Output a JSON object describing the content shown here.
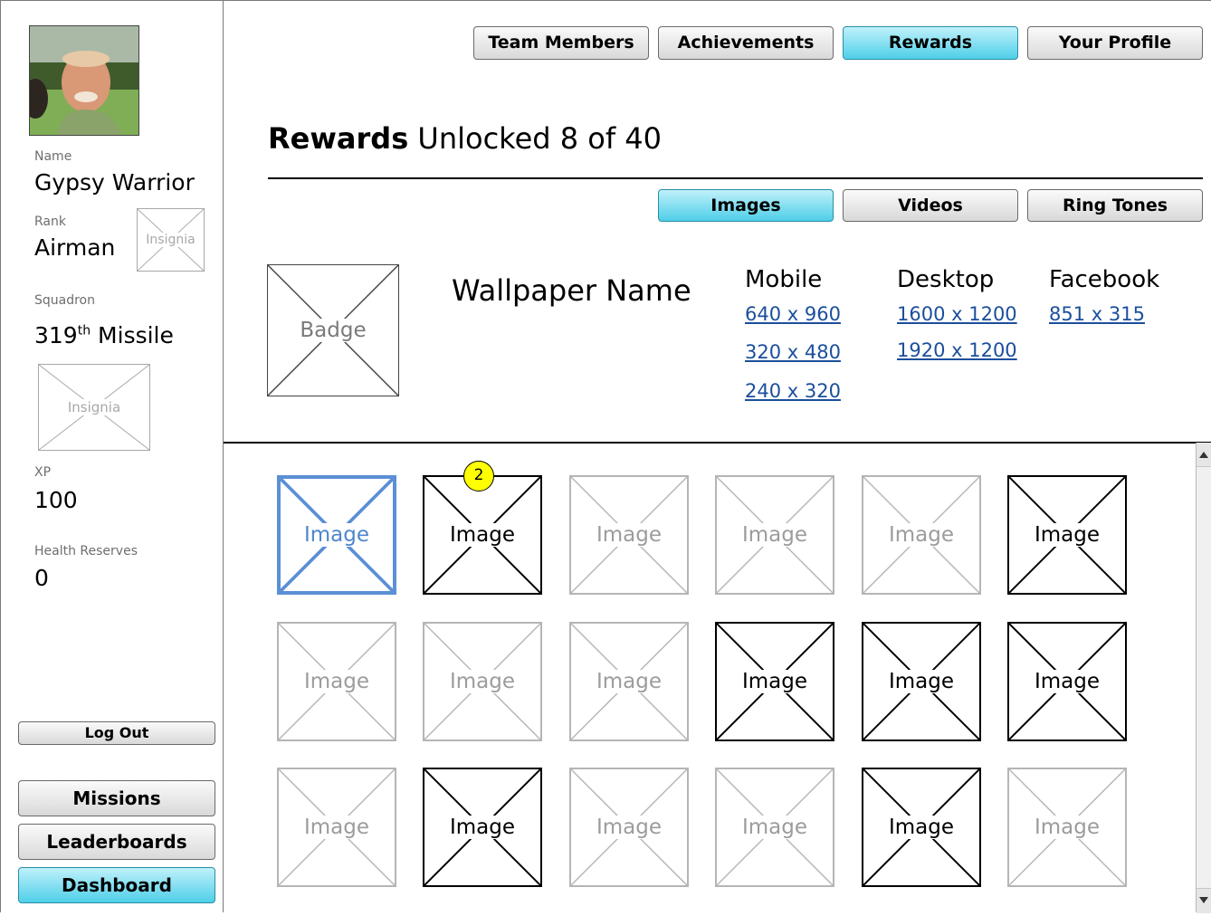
{
  "profile": {
    "name_label": "Name",
    "name": "Gypsy Warrior",
    "rank_label": "Rank",
    "rank": "Airman",
    "rank_insignia": "Insignia",
    "squadron_label": "Squadron",
    "squadron_number": "319",
    "squadron_suffix": "th",
    "squadron_name": "Missile",
    "squadron_insignia": "Insignia",
    "xp_label": "XP",
    "xp": "100",
    "health_label": "Health Reserves",
    "health": "0"
  },
  "sidebar_buttons": {
    "logout": "Log Out",
    "missions": "Missions",
    "leaderboards": "Leaderboards",
    "dashboard": "Dashboard"
  },
  "top_tabs": [
    {
      "label": "Team Members",
      "active": false
    },
    {
      "label": "Achievements",
      "active": false
    },
    {
      "label": "Rewards",
      "active": true
    },
    {
      "label": "Your Profile",
      "active": false
    }
  ],
  "heading": {
    "title": "Rewards",
    "subtitle": "Unlocked 8 of 40"
  },
  "sub_tabs": [
    {
      "label": "Images",
      "active": true
    },
    {
      "label": "Videos",
      "active": false
    },
    {
      "label": "Ring Tones",
      "active": false
    }
  ],
  "detail": {
    "badge": "Badge",
    "wallpaper_name": "Wallpaper Name",
    "columns": [
      {
        "heading": "Mobile",
        "links": [
          "640 x 960",
          "320 x 480",
          "240 x 320"
        ]
      },
      {
        "heading": "Desktop",
        "links": [
          "1600 x 1200",
          "1920 x 1200"
        ]
      },
      {
        "heading": "Facebook",
        "links": [
          "851 x 315"
        ]
      }
    ]
  },
  "grid": {
    "tile_label": "Image",
    "badge_count": "2",
    "rows": [
      [
        "selected",
        "unlocked",
        "locked",
        "locked",
        "locked",
        "unlocked"
      ],
      [
        "locked",
        "locked",
        "locked",
        "unlocked",
        "unlocked",
        "unlocked"
      ],
      [
        "locked",
        "unlocked",
        "locked",
        "locked",
        "unlocked",
        "locked"
      ]
    ]
  },
  "colors": {
    "active_tab": "#4fcfe8",
    "link": "#1b4f9c",
    "selected_tile": "#5b8fd6",
    "count_badge": "#ffff00"
  }
}
